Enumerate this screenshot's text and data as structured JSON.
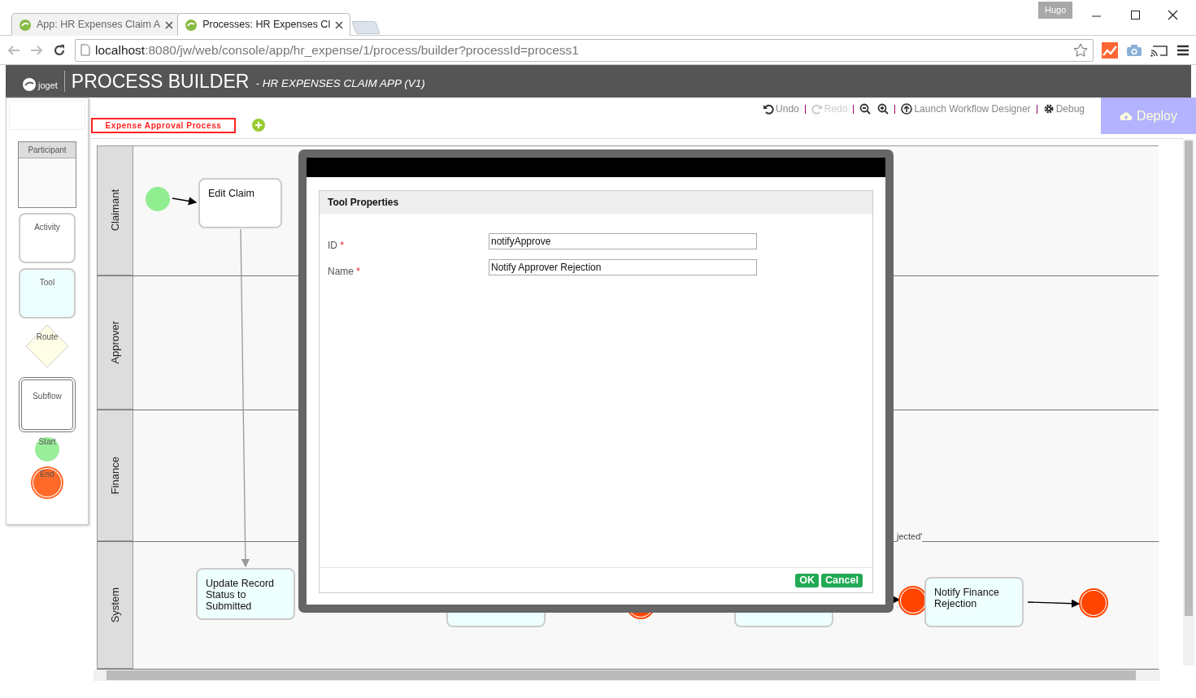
{
  "browser": {
    "tabs": [
      {
        "title": "App: HR Expenses Claim A",
        "selected": false
      },
      {
        "title": "Processes: HR Expenses Cl",
        "selected": true
      }
    ],
    "profile": "Hugo",
    "address": {
      "host": "localhost",
      "path": ":8080/jw/web/console/app/hr_expense/1/process/builder?processId=process1"
    }
  },
  "app_header": {
    "logo": "joget",
    "title": "PROCESS BUILDER",
    "subtitle": "- HR EXPENSES CLAIM APP (V1)"
  },
  "process_tab": {
    "label": "Expense Approval Process",
    "selected": true
  },
  "toolbar": [
    {
      "kind": "undo",
      "label": "Undo",
      "disabled": false
    },
    {
      "kind": "redo",
      "label": "Redo",
      "disabled": true
    },
    {
      "kind": "zoom-out",
      "disabled": false
    },
    {
      "kind": "zoom-in",
      "disabled": false
    },
    {
      "kind": "launch",
      "label": "Launch Workflow Designer",
      "disabled": false
    },
    {
      "kind": "debug",
      "label": "Debug",
      "disabled": false
    }
  ],
  "deploy_button": "Deploy",
  "palette": [
    {
      "kind": "participant",
      "label": "Participant"
    },
    {
      "kind": "activity",
      "label": "Activity"
    },
    {
      "kind": "tool",
      "label": "Tool"
    },
    {
      "kind": "route",
      "label": "Route"
    },
    {
      "kind": "subflow",
      "label": "Subflow"
    },
    {
      "kind": "start",
      "label": "Start"
    },
    {
      "kind": "end",
      "label": "End"
    }
  ],
  "lanes": [
    {
      "name": "Claimant"
    },
    {
      "name": "Approver"
    },
    {
      "name": "Finance"
    },
    {
      "name": "System"
    }
  ],
  "nodes": [
    {
      "kind": "start"
    },
    {
      "kind": "activity",
      "label": "Edit Claim"
    },
    {
      "kind": "tool",
      "label": "Update Record Status to Submitted"
    },
    {
      "kind": "tool"
    },
    {
      "kind": "end"
    },
    {
      "kind": "tool"
    },
    {
      "kind": "end"
    },
    {
      "kind": "tool",
      "label": "Notify Finance Rejection"
    },
    {
      "kind": "end"
    }
  ],
  "transition_label": "jected'",
  "dialog": {
    "title": "Tool Properties",
    "fields": [
      {
        "label": "ID",
        "required": true,
        "value": "notifyApprove"
      },
      {
        "label": "Name",
        "required": true,
        "value": "Notify Approver Rejection"
      }
    ],
    "required_mark": "*",
    "buttons": [
      "OK",
      "Cancel"
    ]
  }
}
